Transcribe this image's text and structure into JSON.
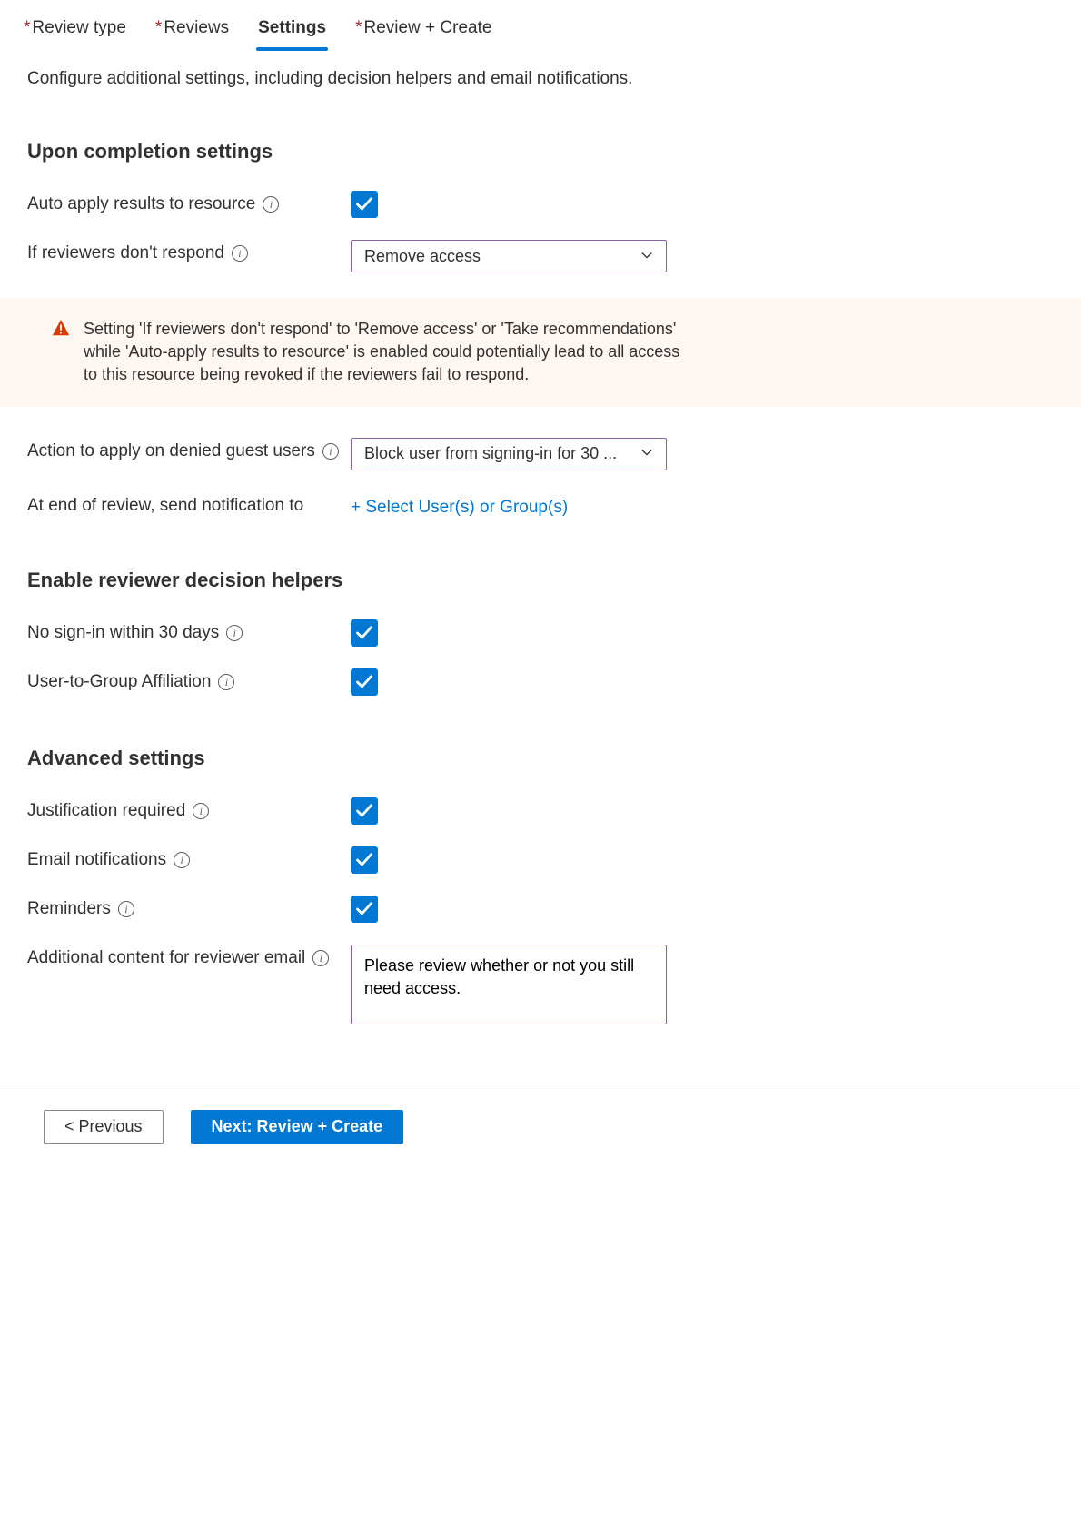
{
  "tabs": [
    {
      "label": "Review type",
      "required": true,
      "active": false
    },
    {
      "label": "Reviews",
      "required": true,
      "active": false
    },
    {
      "label": "Settings",
      "required": false,
      "active": true
    },
    {
      "label": "Review + Create",
      "required": true,
      "active": false
    }
  ],
  "description": "Configure additional settings, including decision helpers and email notifications.",
  "completion": {
    "title": "Upon completion settings",
    "auto_apply_label": "Auto apply results to resource",
    "no_response_label": "If reviewers don't respond",
    "no_response_value": "Remove access",
    "warning": "Setting 'If reviewers don't respond' to 'Remove access' or 'Take recommendations' while 'Auto-apply results to resource' is enabled could potentially lead to all access to this resource being revoked if the reviewers fail to respond.",
    "denied_guest_label": "Action to apply on denied guest users",
    "denied_guest_value": "Block user from signing-in for 30 ...",
    "end_notify_label": "At end of review, send notification to",
    "end_notify_action": "+ Select User(s) or Group(s)"
  },
  "helpers": {
    "title": "Enable reviewer decision helpers",
    "no_signin_label": "No sign-in within 30 days",
    "user_group_label": "User-to-Group Affiliation"
  },
  "advanced": {
    "title": "Advanced settings",
    "justification_label": "Justification required",
    "email_label": "Email notifications",
    "reminders_label": "Reminders",
    "additional_content_label": "Additional content for reviewer email",
    "additional_content_value": "Please review whether or not you still need access."
  },
  "footer": {
    "previous": "< Previous",
    "next": "Next: Review + Create"
  }
}
